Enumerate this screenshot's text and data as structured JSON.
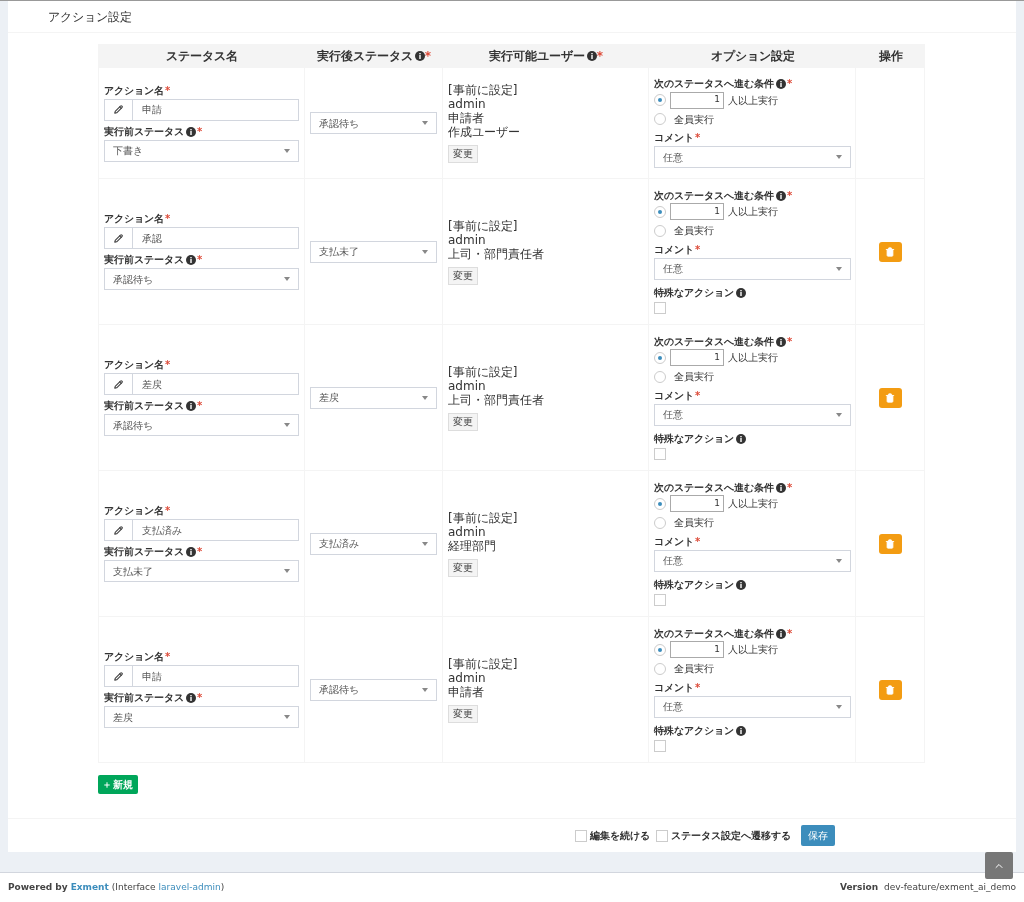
{
  "title": "アクション設定",
  "columns": [
    {
      "label": "ステータス名"
    },
    {
      "label": "実行後ステータス",
      "info": true,
      "mark": "*"
    },
    {
      "label": "実行可能ユーザー",
      "info": true,
      "mark": "*"
    },
    {
      "label": "オプション設定"
    },
    {
      "label": "操作"
    }
  ],
  "rows": [
    {
      "action_label": {
        "text": "アクション名",
        "mark": "*"
      },
      "action_name": "申請",
      "before_label": {
        "text": "実行前ステータス",
        "mark": "*"
      },
      "before_status": "下書き",
      "after_status": "承認待ち",
      "users_heading": "[事前に設定]",
      "users": [
        "admin",
        "申請者",
        "作成ユーザー"
      ],
      "change_button": "変更",
      "condition_label": {
        "text": "次のステータスへ進む条件",
        "mark": "*"
      },
      "conditions": [
        {
          "kind": "count",
          "value": "1",
          "label": "人以上実行",
          "selected": true
        },
        {
          "kind": "all",
          "label": "全員実行",
          "selected": false
        }
      ],
      "comment_label": {
        "text": "コメント",
        "mark": "*"
      },
      "comment": "任意",
      "deletable": false
    },
    {
      "action_label": {
        "text": "アクション名",
        "mark": "*"
      },
      "action_name": "承認",
      "before_label": {
        "text": "実行前ステータス",
        "mark": "*"
      },
      "before_status": "承認待ち",
      "after_status": "支払未了",
      "users_heading": "[事前に設定]",
      "users": [
        "admin",
        "上司・部門責任者"
      ],
      "change_button": "変更",
      "condition_label": {
        "text": "次のステータスへ進む条件",
        "mark": "*"
      },
      "conditions": [
        {
          "kind": "count",
          "value": "1",
          "label": "人以上実行",
          "selected": true
        },
        {
          "kind": "all",
          "label": "全員実行",
          "selected": false
        }
      ],
      "comment_label": {
        "text": "コメント",
        "mark": "*"
      },
      "comment": "任意",
      "special_action": {
        "label": "特殊なアクション",
        "checked": false
      },
      "deletable": true
    },
    {
      "action_label": {
        "text": "アクション名",
        "mark": "*"
      },
      "action_name": "差戻",
      "before_label": {
        "text": "実行前ステータス",
        "mark": "*"
      },
      "before_status": "承認待ち",
      "after_status": "差戻",
      "users_heading": "[事前に設定]",
      "users": [
        "admin",
        "上司・部門責任者"
      ],
      "change_button": "変更",
      "condition_label": {
        "text": "次のステータスへ進む条件",
        "mark": "*"
      },
      "conditions": [
        {
          "kind": "count",
          "value": "1",
          "label": "人以上実行",
          "selected": true
        },
        {
          "kind": "all",
          "label": "全員実行",
          "selected": false
        }
      ],
      "comment_label": {
        "text": "コメント",
        "mark": "*"
      },
      "comment": "任意",
      "special_action": {
        "label": "特殊なアクション",
        "checked": false
      },
      "deletable": true
    },
    {
      "action_label": {
        "text": "アクション名",
        "mark": "*"
      },
      "action_name": "支払済み",
      "before_label": {
        "text": "実行前ステータス",
        "mark": "*"
      },
      "before_status": "支払未了",
      "after_status": "支払済み",
      "users_heading": "[事前に設定]",
      "users": [
        "admin",
        "経理部門"
      ],
      "change_button": "変更",
      "condition_label": {
        "text": "次のステータスへ進む条件",
        "mark": "*"
      },
      "conditions": [
        {
          "kind": "count",
          "value": "1",
          "label": "人以上実行",
          "selected": true
        },
        {
          "kind": "all",
          "label": "全員実行",
          "selected": false
        }
      ],
      "comment_label": {
        "text": "コメント",
        "mark": "*"
      },
      "comment": "任意",
      "special_action": {
        "label": "特殊なアクション",
        "checked": false
      },
      "deletable": true
    },
    {
      "action_label": {
        "text": "アクション名",
        "mark": "*"
      },
      "action_name": "申請",
      "before_label": {
        "text": "実行前ステータス",
        "mark": "*"
      },
      "before_status": "差戻",
      "after_status": "承認待ち",
      "users_heading": "[事前に設定]",
      "users": [
        "admin",
        "申請者"
      ],
      "change_button": "変更",
      "condition_label": {
        "text": "次のステータスへ進む条件",
        "mark": "*"
      },
      "conditions": [
        {
          "kind": "count",
          "value": "1",
          "label": "人以上実行",
          "selected": true
        },
        {
          "kind": "all",
          "label": "全員実行",
          "selected": false
        }
      ],
      "comment_label": {
        "text": "コメント",
        "mark": "*"
      },
      "comment": "任意",
      "special_action": {
        "label": "特殊なアクション",
        "checked": false
      },
      "deletable": true
    }
  ],
  "new_button": "新規",
  "footer_options": [
    {
      "label": "編集を続ける",
      "checked": false
    },
    {
      "label": "ステータス設定へ遷移する",
      "checked": false
    }
  ],
  "save_button": "保存",
  "powered_by": {
    "prefix": "Powered by",
    "brand": "Exment",
    "interface_prefix": "(Interface",
    "interface_link": "laravel-admin",
    "interface_suffix": ")"
  },
  "version": {
    "label": "Version",
    "value": "dev-feature/exment_ai_demo"
  }
}
